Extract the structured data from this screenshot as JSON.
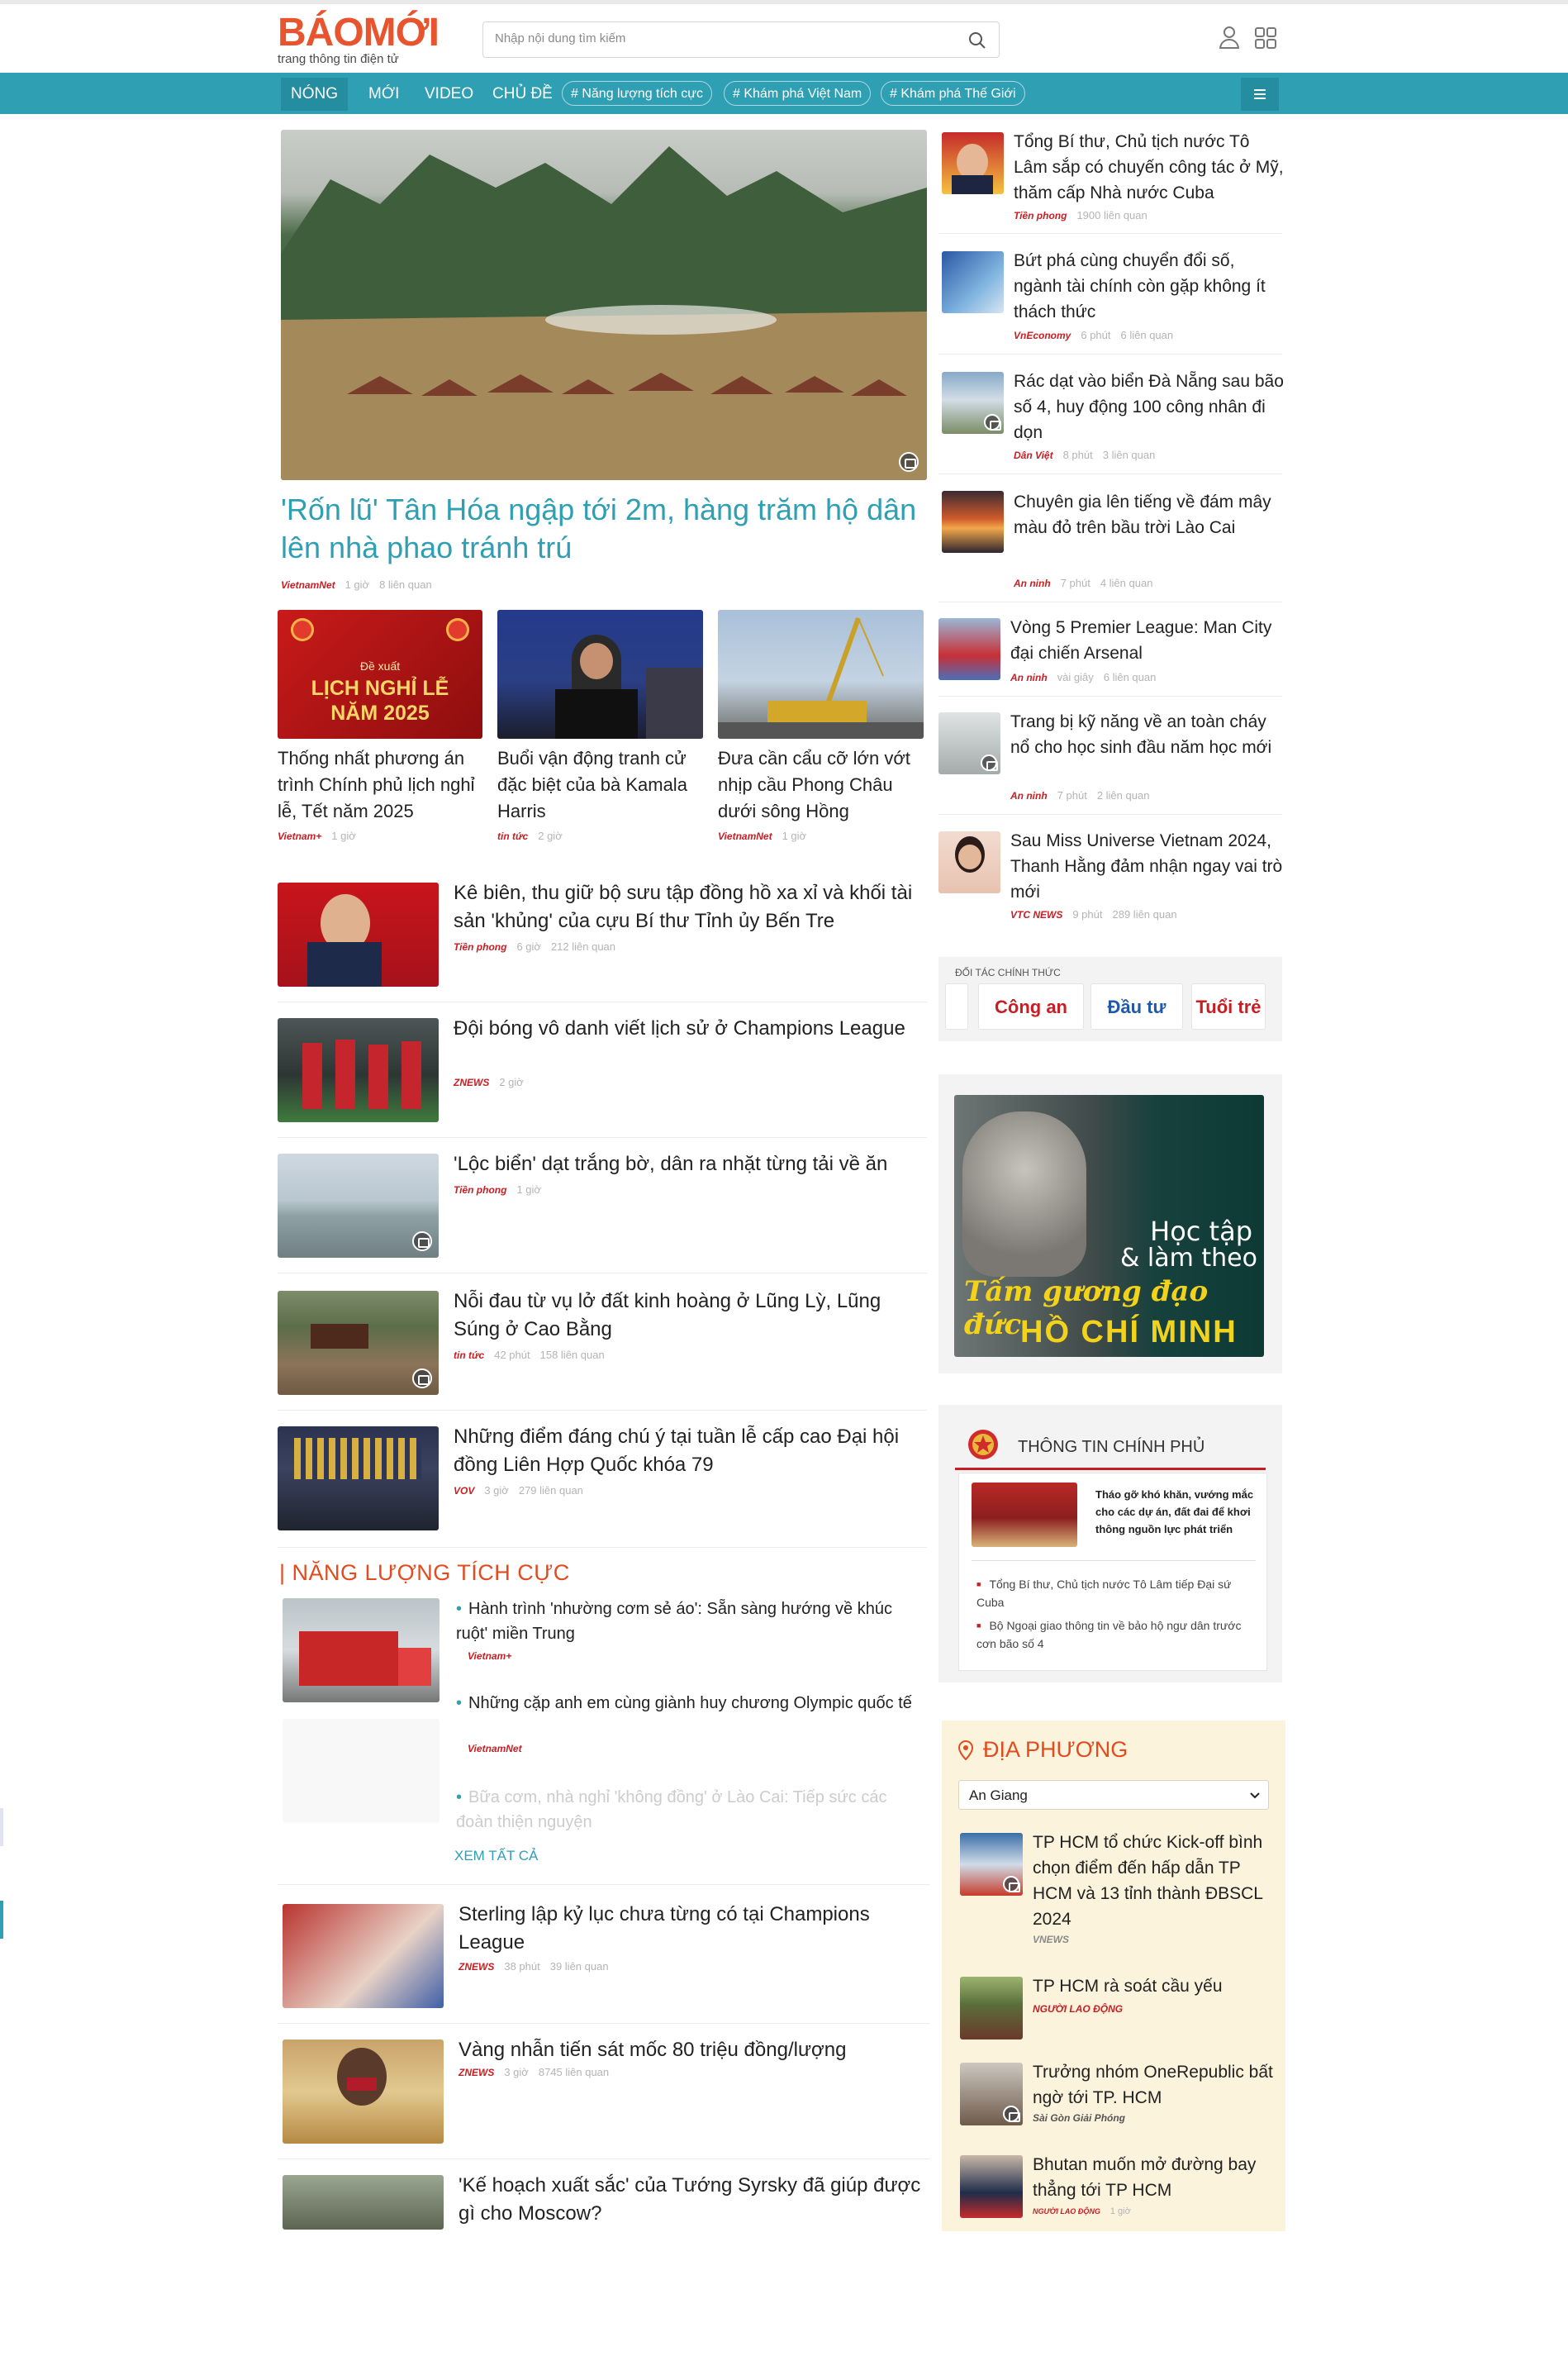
{
  "header": {
    "logo_word": "BÁOMỚI",
    "logo_tagline": "trang thông tin điện tử",
    "search_placeholder": "Nhập nội dung tìm kiếm"
  },
  "nav": {
    "items": [
      "NÓNG",
      "MỚI",
      "VIDEO",
      "CHỦ ĐỀ"
    ],
    "tags": [
      "# Năng lượng tích cực",
      "# Khám phá Việt Nam",
      "# Khám phá Thế Giới"
    ]
  },
  "hero": {
    "title": "'Rốn lũ' Tân Hóa ngập tới 2m, hàng trăm hộ dân lên nhà phao tránh trú",
    "source": "VietnamNet",
    "time": "1 giờ",
    "related": "8 liên quan"
  },
  "grid": [
    {
      "banner_top": "Đề xuất",
      "banner_title": "LỊCH NGHỈ LỄ NĂM 2025",
      "title": "Thống nhất phương án trình Chính phủ lịch nghỉ lễ, Tết năm 2025",
      "source": "Vietnam+",
      "time": "1 giờ"
    },
    {
      "title": "Buổi vận động tranh cử đặc biệt của bà Kamala Harris",
      "source": "tin tức",
      "time": "2 giờ"
    },
    {
      "title": "Đưa cần cẩu cỡ lớn vớt nhịp cầu Phong Châu dưới sông Hồng",
      "source": "VietnamNet",
      "time": "1 giờ"
    }
  ],
  "list": [
    {
      "title": "Kê biên, thu giữ bộ sưu tập đồng hồ xa xỉ và khối tài sản 'khủng' của cựu Bí thư Tỉnh ủy Bến Tre",
      "source": "Tiền phong",
      "time": "6 giờ",
      "related": "212 liên quan"
    },
    {
      "title": "Đội bóng vô danh viết lịch sử ở Champions League",
      "source": "ZNEWS",
      "time": "2 giờ"
    },
    {
      "title": "'Lộc biển' dạt trắng bờ, dân ra nhặt từng tải về ăn",
      "source": "Tiền phong",
      "time": "1 giờ"
    },
    {
      "title": "Nỗi đau từ vụ lở đất kinh hoàng ở Lũng Lỳ, Lũng Súng ở Cao Bằng",
      "source": "tin tức",
      "time": "42 phút",
      "related": "158 liên quan"
    },
    {
      "title": "Những điểm đáng chú ý tại tuần lễ cấp cao Đại hội đồng Liên Hợp Quốc khóa 79",
      "source": "VOV",
      "time": "3 giờ",
      "related": "279 liên quan"
    }
  ],
  "positive": {
    "section_title": "| NĂNG LƯỢNG TÍCH CỰC",
    "items": [
      {
        "title": "Hành trình 'nhường cơm sẻ áo': Sẵn sàng hướng về khúc ruột' miền Trung",
        "source": "Vietnam+"
      },
      {
        "title": "Những cặp anh em cùng giành huy chương Olympic quốc tế",
        "source": "VietnamNet"
      },
      {
        "title": "Bữa cơm, nhà nghỉ 'không đồng' ở Lào Cai: Tiếp sức các đoàn thiện nguyện"
      }
    ],
    "see_all": "XEM TẤT CẢ"
  },
  "list2": [
    {
      "title": "Sterling lập kỷ lục chưa từng có tại Champions League",
      "source": "ZNEWS",
      "time": "38 phút",
      "related": "39 liên quan"
    },
    {
      "title": "Vàng nhẫn tiến sát mốc 80 triệu đồng/lượng",
      "source": "ZNEWS",
      "time": "3 giờ",
      "related": "8745 liên quan"
    },
    {
      "title": "'Kế hoạch xuất sắc' của Tướng Syrsky đã giúp được gì cho Moscow?"
    }
  ],
  "sidebar": [
    {
      "title": "Tổng Bí thư, Chủ tịch nước Tô Lâm sắp có chuyến công tác ở Mỹ, thăm cấp Nhà nước Cuba",
      "source": "Tiền phong",
      "time": "1900 liên quan"
    },
    {
      "title": "Bứt phá cùng chuyển đổi số, ngành tài chính còn gặp không ít thách thức",
      "source": "VnEconomy",
      "time": "6 phút",
      "related": "6 liên quan"
    },
    {
      "title": "Rác dạt vào biển Đà Nẵng sau bão số 4, huy động 100 công nhân đi dọn",
      "source": "Dân Việt",
      "time": "8 phút",
      "related": "3 liên quan"
    },
    {
      "title": "Chuyên gia lên tiếng về đám mây màu đỏ trên bầu trời Lào Cai",
      "source": "An ninh",
      "time": "7 phút",
      "related": "4 liên quan"
    },
    {
      "title": "Vòng 5 Premier League: Man City đại chiến Arsenal",
      "source": "An ninh",
      "time": "vài giây",
      "related": "6 liên quan"
    },
    {
      "title": "Trang bị kỹ năng về an toàn cháy nổ cho học sinh đầu năm học mới",
      "source": "An ninh",
      "time": "7 phút",
      "related": "2 liên quan"
    },
    {
      "title": "Sau Miss Universe Vietnam 2024, Thanh Hằng đảm nhận ngay vai trò mới",
      "source": "VTC NEWS",
      "time": "9 phút",
      "related": "289 liên quan"
    }
  ],
  "partners": {
    "label": "ĐỐI TÁC CHÍNH THỨC",
    "items": [
      "Công an",
      "Đầu tư",
      "Tuổi trẻ"
    ]
  },
  "banner_hcm": {
    "line1": "Học tập",
    "line2": "& làm theo",
    "line3": "Tấm gương đạo đức",
    "line4": "HỒ CHÍ MINH"
  },
  "gov": {
    "title": "THÔNG TIN CHÍNH PHỦ",
    "feature": "Tháo gỡ khó khăn, vướng mắc cho các dự án, đất đai để khơi thông nguồn lực phát triển",
    "items": [
      "Tổng Bí thư, Chủ tịch nước Tô Lâm tiếp Đại sứ Cuba",
      "Bộ Ngoại giao thông tin về bảo hộ ngư dân trước cơn bão số 4"
    ]
  },
  "local": {
    "title": "ĐỊA PHƯƠNG",
    "selected": "An Giang",
    "items": [
      {
        "title": "TP HCM tổ chức Kick-off bình chọn điểm đến hấp dẫn TP HCM và 13 tỉnh thành ĐBSCL 2024",
        "source": "VNEWS"
      },
      {
        "title": "TP HCM rà soát cầu yếu",
        "source": "NGƯỜI LAO ĐỘNG"
      },
      {
        "title": "Trưởng nhóm OneRepublic bất ngờ tới TP. HCM",
        "source": "Sài Gòn Giải Phóng"
      },
      {
        "title": "Bhutan muốn mở đường bay thẳng tới TP HCM",
        "source": "NGƯỜI LAO ĐỘNG",
        "time": "1 giờ"
      }
    ]
  },
  "colors": {
    "brand": "#e8542e",
    "nav": "#2f9fb4",
    "accent": "#e24b1e",
    "local_bg": "#fbf3dc"
  }
}
